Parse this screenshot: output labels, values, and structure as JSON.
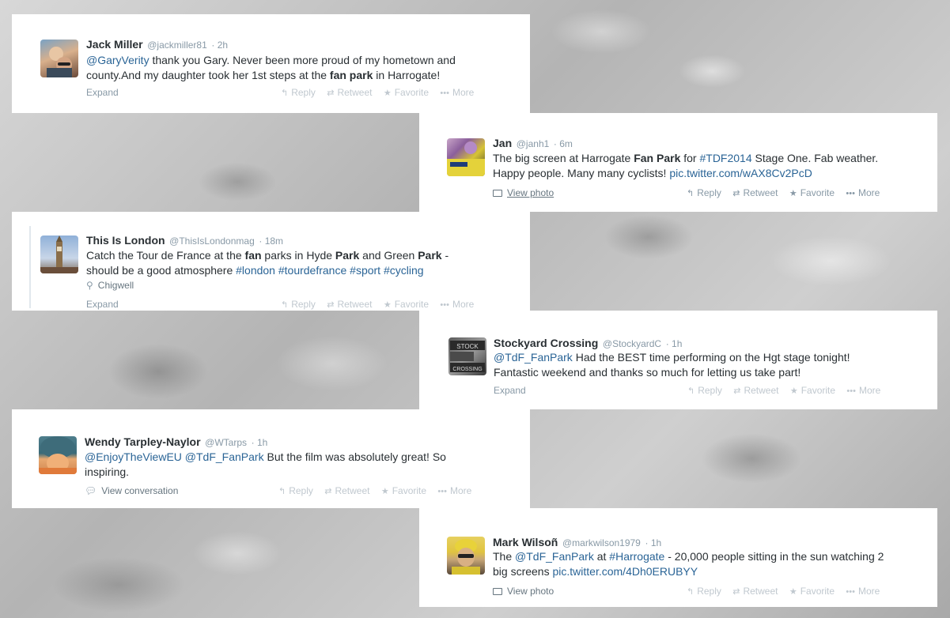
{
  "tweets": [
    {
      "name": "Jack Miller",
      "handle": "@jackmiller81",
      "time": "· 2h",
      "text": [
        {
          "t": "@GaryVerity",
          "s": "link"
        },
        {
          "t": " thank you Gary. Never been more proud of my hometown and county.And my daughter took her 1st steps at the "
        },
        {
          "t": "fan park",
          "s": "bold"
        },
        {
          "t": " in Harrogate!"
        }
      ],
      "footer_left": "Expand",
      "actions": {
        "reply": "Reply",
        "retweet": "Retweet",
        "favorite": "Favorite",
        "more": "More"
      }
    },
    {
      "name": "Jan",
      "handle": "@janh1",
      "time": "· 6m",
      "text": [
        {
          "t": "The big screen at Harrogate "
        },
        {
          "t": "Fan Park",
          "s": "bold"
        },
        {
          "t": " for "
        },
        {
          "t": "#TDF2014",
          "s": "link"
        },
        {
          "t": "  Stage One. Fab weather. Happy people. Many many cyclists! "
        },
        {
          "t": "pic.twitter.com/wAX8Cv2PcD",
          "s": "link"
        }
      ],
      "footer_left": "View photo",
      "actions": {
        "reply": "Reply",
        "retweet": "Retweet",
        "favorite": "Favorite",
        "more": "More"
      }
    },
    {
      "name": "This Is London",
      "handle": "@ThisIsLondonmag",
      "time": "· 18m",
      "text": [
        {
          "t": "Catch the Tour de France at the "
        },
        {
          "t": "fan",
          "s": "bold"
        },
        {
          "t": " parks in Hyde "
        },
        {
          "t": "Park",
          "s": "bold"
        },
        {
          "t": " and Green "
        },
        {
          "t": "Park",
          "s": "bold"
        },
        {
          "t": " - should be a good atmosphere "
        },
        {
          "t": "#london",
          "s": "link"
        },
        {
          "t": " "
        },
        {
          "t": "#tourdefrance",
          "s": "link"
        },
        {
          "t": " "
        },
        {
          "t": "#sport",
          "s": "link"
        },
        {
          "t": " "
        },
        {
          "t": "#cycling",
          "s": "link"
        }
      ],
      "location": "Chigwell",
      "footer_left": "Expand",
      "actions": {
        "reply": "Reply",
        "retweet": "Retweet",
        "favorite": "Favorite",
        "more": "More"
      }
    },
    {
      "name": "Stockyard Crossing",
      "handle": "@StockyardC",
      "time": "· 1h",
      "text": [
        {
          "t": "@TdF_FanPark",
          "s": "link"
        },
        {
          "t": " Had the BEST time performing on the Hgt stage tonight! Fantastic weekend and thanks so much for letting us take part!"
        }
      ],
      "footer_left": "Expand",
      "actions": {
        "reply": "Reply",
        "retweet": "Retweet",
        "favorite": "Favorite",
        "more": "More"
      }
    },
    {
      "name": "Wendy Tarpley-Naylor",
      "handle": "@WTarps",
      "time": "· 1h",
      "text": [
        {
          "t": "@EnjoyTheViewEU",
          "s": "link"
        },
        {
          "t": " "
        },
        {
          "t": "@TdF_FanPark",
          "s": "link"
        },
        {
          "t": " But the film was absolutely great!  So inspiring."
        }
      ],
      "footer_left": "View conversation",
      "actions": {
        "reply": "Reply",
        "retweet": "Retweet",
        "favorite": "Favorite",
        "more": "More"
      }
    },
    {
      "name": "Mark Wilsoñ",
      "handle": "@markwilson1979",
      "time": "· 1h",
      "text": [
        {
          "t": "The "
        },
        {
          "t": "@TdF_FanPark",
          "s": "link"
        },
        {
          "t": " at "
        },
        {
          "t": "#Harrogate",
          "s": "link"
        },
        {
          "t": " - 20,000 people sitting in the sun watching 2 big screens "
        },
        {
          "t": "pic.twitter.com/4Dh0ERUBYY",
          "s": "link"
        }
      ],
      "footer_left": "View photo",
      "actions": {
        "reply": "Reply",
        "retweet": "Retweet",
        "favorite": "Favorite",
        "more": "More"
      }
    }
  ],
  "icons": {
    "reply": "reply-icon",
    "retweet": "retweet-icon",
    "favorite": "star-icon",
    "more": "more-dots-icon",
    "photo": "photo-icon",
    "conversation": "speech-bubble-icon",
    "location": "map-pin-icon"
  }
}
